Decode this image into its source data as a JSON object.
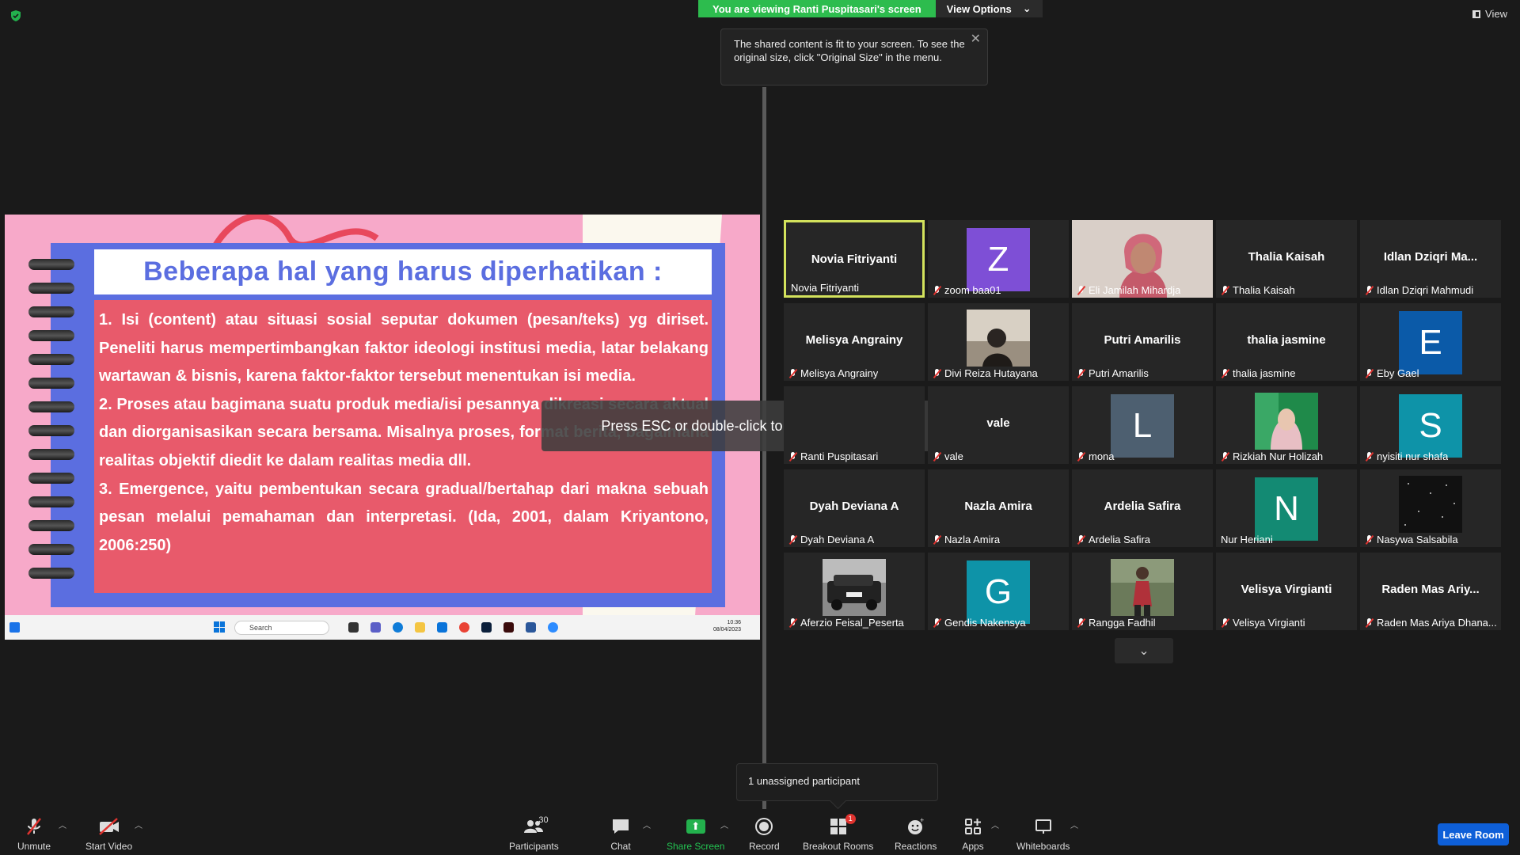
{
  "banner": {
    "viewing_text": "You are viewing Ranti Puspitasari's screen",
    "view_options_label": "View Options",
    "tooltip_text": "The shared content is fit to your screen. To see the original size, click \"Original Size\" in the menu.",
    "view_label": "View"
  },
  "slide": {
    "title": "Beberapa hal yang harus diperhatikan :",
    "paragraphs": [
      "1. Isi (content) atau situasi sosial seputar dokumen (pesan/teks) yg diriset. Peneliti harus mempertimbangkan faktor ideologi institusi media, latar belakang wartawan & bisnis, karena faktor-faktor tersebut menentukan isi media.",
      "2. Proses atau bagimana suatu produk media/isi pesannya dikreasi secara aktual dan diorganisasikan secara bersama. Misalnya proses, format berita, bagaimana realitas objektif diedit ke dalam realitas media dll.",
      "3. Emergence, yaitu pembentukan secara gradual/bertahap dari makna sebuah pesan melalui pemahaman dan interpretasi. (Ida, 2001, dalam Kriyantono, 2006:250)"
    ],
    "taskbar": {
      "search_placeholder": "Search",
      "time": "10:36",
      "date": "08/04/2023"
    }
  },
  "esc_message": "Press ESC or double-click to exit full screen mode",
  "gallery": {
    "tiles": [
      {
        "name": "Novia Fitriyanti",
        "center": "Novia Fitriyanti",
        "muted": false,
        "active": true
      },
      {
        "name": "zoom baa01",
        "avatar": "Z",
        "avatar_color": "#7e4fd6",
        "muted": true
      },
      {
        "name": "Eli Jamilah Mihardja",
        "photo": "woman-hijab",
        "muted": true
      },
      {
        "name": "Thalia Kaisah",
        "center": "Thalia Kaisah",
        "muted": true
      },
      {
        "name": "Idlan Dziqri Mahmudi",
        "center": "Idlan  Dziqri  Ma...",
        "muted": true
      },
      {
        "name": "Melisya Angrainy",
        "center": "Melisya Angrainy",
        "muted": true
      },
      {
        "name": "Divi Reiza Hutayana",
        "photo": "person-dark",
        "muted": true
      },
      {
        "name": "Putri Amarilis",
        "center": "Putri Amarilis",
        "muted": true
      },
      {
        "name": "thalia jasmine",
        "center": "thalia jasmine",
        "muted": true
      },
      {
        "name": "Eby Gael",
        "avatar": "E",
        "avatar_color": "#0b5aa8",
        "muted": true
      },
      {
        "name": "Ranti Puspitasari",
        "center": "",
        "muted": true
      },
      {
        "name": "vale",
        "center": "vale",
        "muted": true
      },
      {
        "name": "mona",
        "avatar": "L",
        "avatar_color": "#4d5f70",
        "muted": true
      },
      {
        "name": "Rizkiah Nur Holizah",
        "photo": "woman-hijab-green",
        "muted": true
      },
      {
        "name": "nyisiti nur shafa",
        "avatar": "S",
        "avatar_color": "#0e93a8",
        "muted": true
      },
      {
        "name": "Dyah Deviana A",
        "center": "Dyah Deviana A",
        "muted": true
      },
      {
        "name": "Nazla Amira",
        "center": "Nazla Amira",
        "muted": true
      },
      {
        "name": "Ardelia Safira",
        "center": "Ardelia Safira",
        "muted": true
      },
      {
        "name": "Nur Heriani",
        "avatar": "N",
        "avatar_color": "#138a73",
        "muted": false
      },
      {
        "name": "Nasywa Salsabila",
        "photo": "stars",
        "muted": true
      },
      {
        "name": "Aferzio Feisal_Peserta",
        "photo": "car",
        "muted": true
      },
      {
        "name": "Gendis Nakensya",
        "avatar": "G",
        "avatar_color": "#0e93a8",
        "muted": true
      },
      {
        "name": "Rangga Fadhil",
        "photo": "person-red",
        "muted": true
      },
      {
        "name": "Velisya Virgianti",
        "center": "Velisya Virgianti",
        "muted": true
      },
      {
        "name": "Raden Mas Ariya Dhana...",
        "center": "Raden Mas Ariy...",
        "muted": true
      }
    ]
  },
  "unassigned_text": "1 unassigned participant",
  "toolbar": {
    "unmute": "Unmute",
    "start_video": "Start Video",
    "participants": "Participants",
    "participant_count": "30",
    "chat": "Chat",
    "share_screen": "Share Screen",
    "record": "Record",
    "breakout_rooms": "Breakout Rooms",
    "breakout_badge": "1",
    "reactions": "Reactions",
    "apps": "Apps",
    "whiteboards": "Whiteboards",
    "leave_room": "Leave Room"
  },
  "colors": {
    "accent_green": "#2dbc4e",
    "active_border": "#d3e25c",
    "leave_blue": "#0e5fd8",
    "slide_blue": "#5b6ee0",
    "slide_red": "#e85a6b",
    "slide_pink": "#f7a9c9"
  }
}
